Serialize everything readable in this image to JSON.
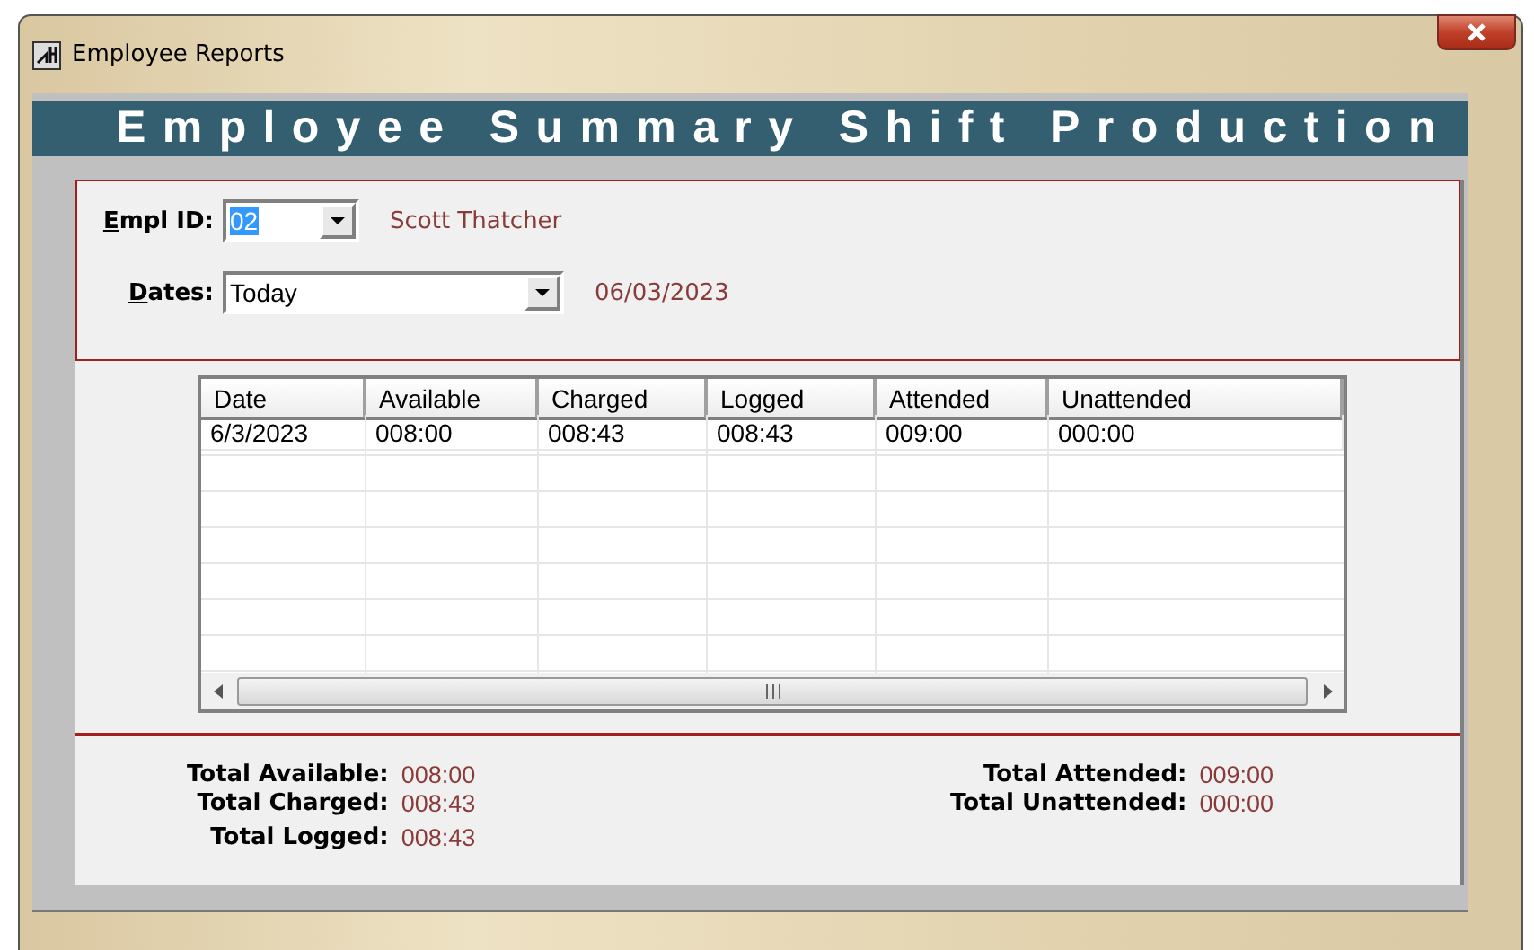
{
  "window": {
    "title": "Employee Reports"
  },
  "banner": "Employee Summary Shift Production",
  "filters": [
    {
      "kind": "combo",
      "label": "Empl ID:",
      "value": "02",
      "highlighted": true,
      "note": "Scott Thatcher"
    },
    {
      "kind": "combo",
      "label": "Dates:",
      "value": "Today",
      "highlighted": false,
      "note": "06/03/2023"
    }
  ],
  "table": {
    "columns": [
      "Date",
      "Available",
      "Charged",
      "Logged",
      "Attended",
      "Unattended"
    ],
    "rows": [
      [
        "6/3/2023",
        "008:00",
        "008:43",
        "008:43",
        "009:00",
        "000:00"
      ]
    ]
  },
  "totals": [
    [
      {
        "label": "Total Available:",
        "value": "008:00"
      },
      {
        "label": "Total Charged:",
        "value": "008:43"
      },
      {
        "label": "Total Logged:",
        "value": "008:43"
      }
    ],
    [
      {
        "label": "Total Attended:",
        "value": "009:00"
      },
      {
        "label": "Total Unattended:",
        "value": "000:00"
      }
    ]
  ]
}
